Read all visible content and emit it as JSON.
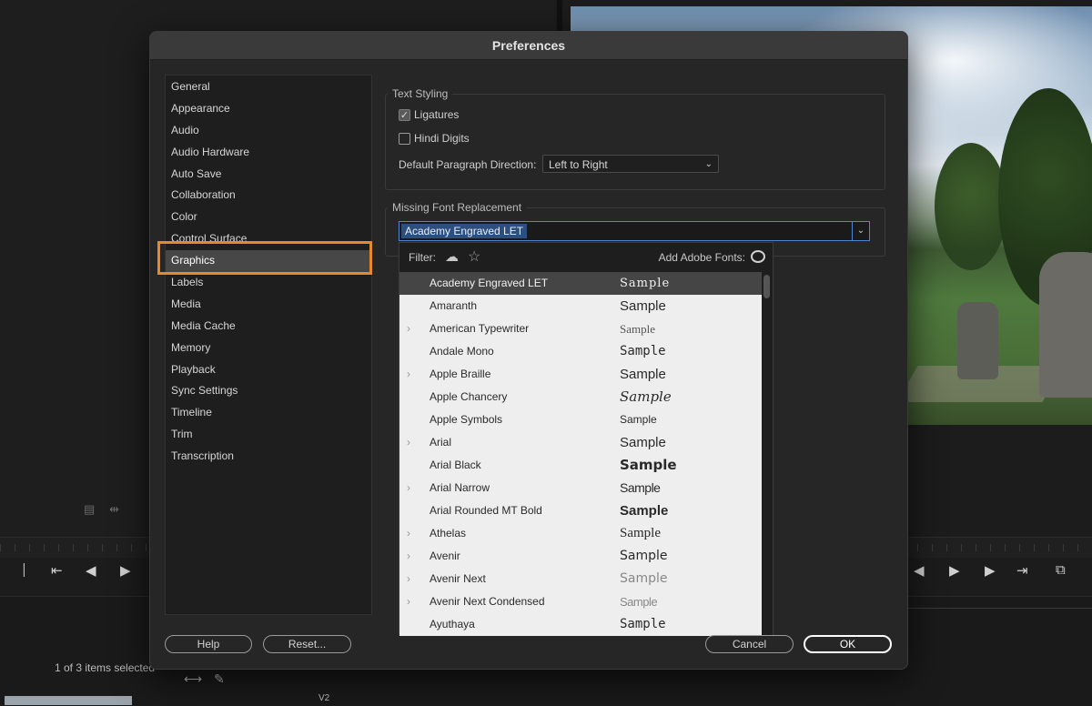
{
  "background": {
    "items_selected": "1 of 3 items selected",
    "track_labels": [
      "V2"
    ]
  },
  "dialog": {
    "title": "Preferences",
    "sidebar": [
      "General",
      "Appearance",
      "Audio",
      "Audio Hardware",
      "Auto Save",
      "Collaboration",
      "Color",
      "Control Surface",
      "Graphics",
      "Labels",
      "Media",
      "Media Cache",
      "Memory",
      "Playback",
      "Sync Settings",
      "Timeline",
      "Trim",
      "Transcription"
    ],
    "selected_item": "Graphics",
    "text_styling": {
      "legend": "Text Styling",
      "ligatures_label": "Ligatures",
      "ligatures_checked": true,
      "hindi_digits_label": "Hindi Digits",
      "hindi_digits_checked": false,
      "direction_label": "Default Paragraph Direction:",
      "direction_value": "Left to Right"
    },
    "missing_font": {
      "legend": "Missing Font Replacement",
      "selected_font": "Academy Engraved LET",
      "filter_label": "Filter:",
      "add_fonts_label": "Add Adobe Fonts:",
      "fonts": [
        {
          "name": "Academy Engraved LET",
          "sample": "Sample",
          "has_children": false,
          "selected": true
        },
        {
          "name": "Amaranth",
          "sample": "Sample",
          "has_children": false
        },
        {
          "name": "American Typewriter",
          "sample": "Sample",
          "has_children": true
        },
        {
          "name": "Andale Mono",
          "sample": "Sample",
          "has_children": false
        },
        {
          "name": "Apple Braille",
          "sample": "Sample",
          "has_children": true
        },
        {
          "name": "Apple Chancery",
          "sample": "Sample",
          "has_children": false
        },
        {
          "name": "Apple Symbols",
          "sample": "Sample",
          "has_children": false
        },
        {
          "name": "Arial",
          "sample": "Sample",
          "has_children": true
        },
        {
          "name": "Arial Black",
          "sample": "Sample",
          "has_children": false
        },
        {
          "name": "Arial Narrow",
          "sample": "Sample",
          "has_children": true
        },
        {
          "name": "Arial Rounded MT Bold",
          "sample": "Sample",
          "has_children": false
        },
        {
          "name": "Athelas",
          "sample": "Sample",
          "has_children": true
        },
        {
          "name": "Avenir",
          "sample": "Sample",
          "has_children": true
        },
        {
          "name": "Avenir Next",
          "sample": "Sample",
          "has_children": true
        },
        {
          "name": "Avenir Next Condensed",
          "sample": "Sample",
          "has_children": true
        },
        {
          "name": "Ayuthaya",
          "sample": "Sample",
          "has_children": false
        }
      ]
    },
    "buttons": {
      "help": "Help",
      "reset": "Reset...",
      "cancel": "Cancel",
      "ok": "OK"
    },
    "colors": {
      "highlight": "#e5892c",
      "accent": "#4e86d2"
    }
  }
}
